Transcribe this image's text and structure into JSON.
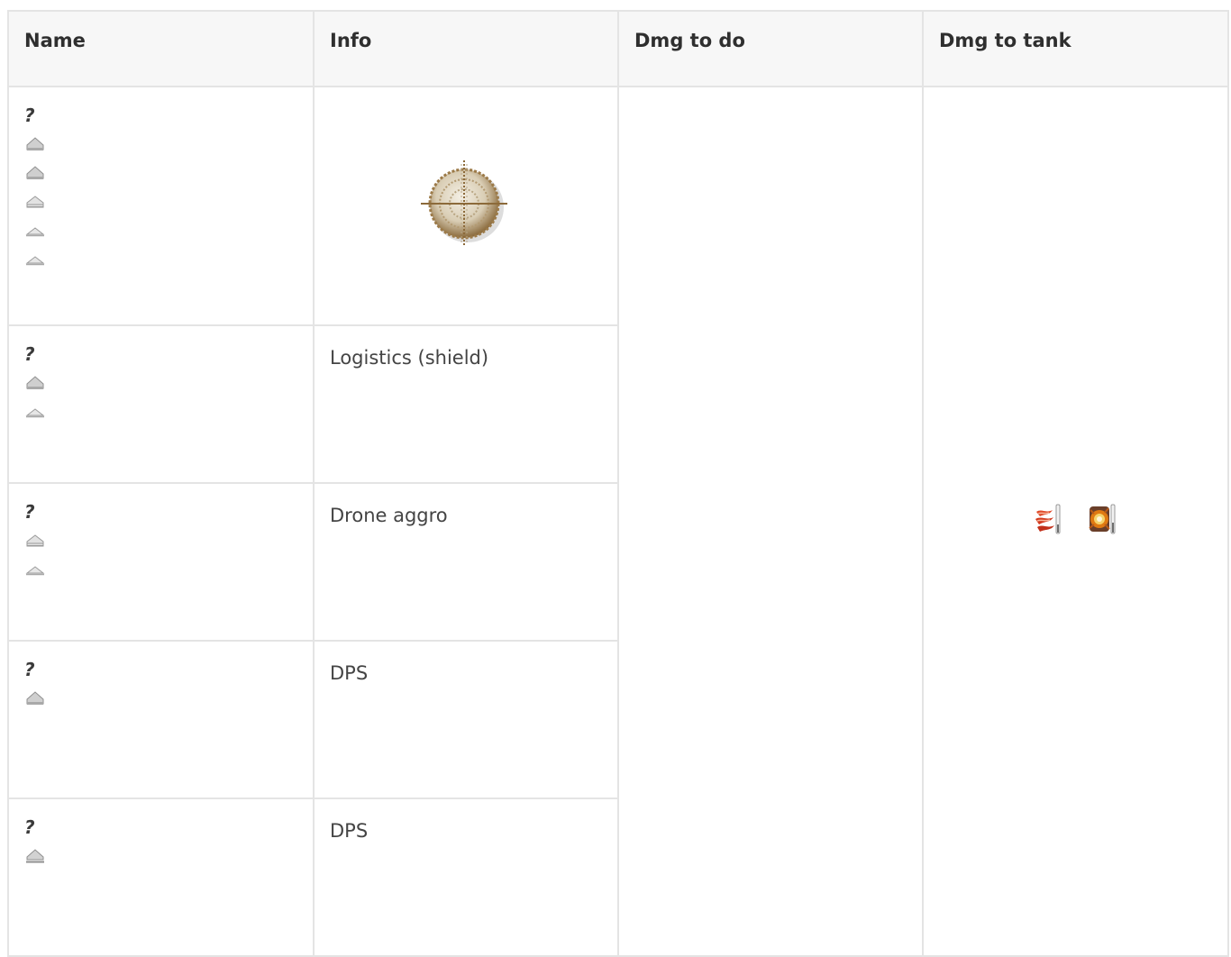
{
  "headers": {
    "name": "Name",
    "info": "Info",
    "dmg_to_do": "Dmg to do",
    "dmg_to_tank": "Dmg to tank"
  },
  "rows": [
    {
      "name": "?",
      "ships": [
        "ship-full-icon",
        "ship-full-icon",
        "ship-striped-icon",
        "ship-flat-icon",
        "ship-flat-icon"
      ],
      "info": "",
      "info_icon": "crosshair-target-icon"
    },
    {
      "name": "?",
      "ships": [
        "ship-full-icon",
        "ship-flat-icon"
      ],
      "info": "Logistics (shield)"
    },
    {
      "name": "?",
      "ships": [
        "ship-striped-icon",
        "ship-flat-icon"
      ],
      "info": "Drone aggro"
    },
    {
      "name": "?",
      "ships": [
        "ship-full-icon"
      ],
      "info": "DPS"
    },
    {
      "name": "?",
      "ships": [
        "ship-base-icon"
      ],
      "info": "DPS"
    }
  ],
  "dmg_to_tank_icons": [
    "thermal-damage-icon",
    "explosive-damage-icon"
  ],
  "colors": {
    "border": "#e4e4e4",
    "header_bg": "#f7f7f7",
    "thermal": "#d23a1e",
    "explosive": "#e07a12"
  }
}
